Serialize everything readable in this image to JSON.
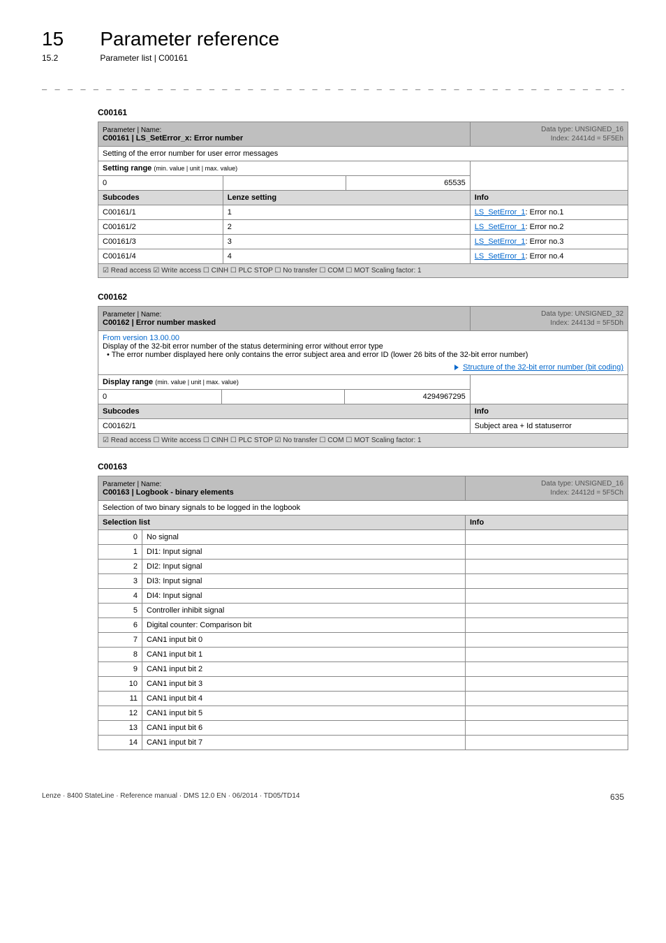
{
  "header": {
    "chapter_num": "15",
    "chapter_title": "Parameter reference",
    "section_num": "15.2",
    "section_title": "Parameter list | C00161",
    "dashes": "_ _ _ _ _ _ _ _ _ _ _ _ _ _ _ _ _ _ _ _ _ _ _ _ _ _ _ _ _ _ _ _ _ _ _ _ _ _ _ _ _ _ _ _ _ _ _ _ _ _ _ _ _ _ _ _ _ _ _ _ _ _ _ _"
  },
  "tables": {
    "t1": {
      "anchor": "C00161",
      "name_line1": "Parameter | Name:",
      "name_line2": "C00161 | LS_SetError_x: Error number",
      "dtype_line1": "Data type: UNSIGNED_16",
      "dtype_line2": "Index: 24414d = 5F5Eh",
      "desc": "Setting of the error number for user error messages",
      "setting_label": "Setting range",
      "setting_note": "(min. value | unit | max. value)",
      "min": "0",
      "max": "65535",
      "subcodes_hdr": "Subcodes",
      "lenze_hdr": "Lenze setting",
      "info_hdr": "Info",
      "rows": [
        {
          "sub": "C00161/1",
          "set": "1",
          "link": "LS_SetError_1",
          "rest": ": Error no.1"
        },
        {
          "sub": "C00161/2",
          "set": "2",
          "link": "LS_SetError_1",
          "rest": ": Error no.2"
        },
        {
          "sub": "C00161/3",
          "set": "3",
          "link": "LS_SetError_1",
          "rest": ": Error no.3"
        },
        {
          "sub": "C00161/4",
          "set": "4",
          "link": "LS_SetError_1",
          "rest": ": Error no.4"
        }
      ],
      "footer": "☑ Read access   ☑ Write access   ☐ CINH   ☐ PLC STOP   ☐ No transfer   ☐ COM   ☐ MOT     Scaling factor: 1"
    },
    "t2": {
      "anchor": "C00162",
      "name_line1": "Parameter | Name:",
      "name_line2": "C00162 | Error number masked",
      "dtype_line1": "Data type: UNSIGNED_32",
      "dtype_line2": "Index: 24413d = 5F5Dh",
      "version": "From version 13.00.00",
      "desc_text": "Display of the 32-bit error number of the status determining error without error type",
      "bullet": "• The error number displayed here only contains the error subject area and error ID (lower 26 bits of the 32-bit error number)",
      "struct_link": "Structure of the 32-bit error number (bit coding)",
      "display_label": "Display range",
      "display_note": "(min. value | unit | max. value)",
      "min": "0",
      "max": "4294967295",
      "subcodes_hdr": "Subcodes",
      "info_hdr": "Info",
      "row_sub": "C00162/1",
      "row_info": "Subject area + Id statuserror",
      "footer": "☑ Read access   ☐ Write access   ☐ CINH   ☐ PLC STOP   ☑ No transfer   ☐ COM   ☐ MOT     Scaling factor: 1"
    },
    "t3": {
      "anchor": "C00163",
      "name_line1": "Parameter | Name:",
      "name_line2": "C00163 | Logbook - binary elements",
      "dtype_line1": "Data type: UNSIGNED_16",
      "dtype_line2": "Index: 24412d = 5F5Ch",
      "desc": "Selection of two binary signals to be logged in the logbook",
      "sel_hdr": "Selection list",
      "info_hdr": "Info",
      "rows": [
        {
          "n": "0",
          "txt": "No signal"
        },
        {
          "n": "1",
          "txt": "DI1: Input signal"
        },
        {
          "n": "2",
          "txt": "DI2: Input signal"
        },
        {
          "n": "3",
          "txt": "DI3: Input signal"
        },
        {
          "n": "4",
          "txt": "DI4: Input signal"
        },
        {
          "n": "5",
          "txt": "Controller inhibit signal"
        },
        {
          "n": "6",
          "txt": "Digital counter: Comparison bit"
        },
        {
          "n": "7",
          "txt": "CAN1 input bit 0"
        },
        {
          "n": "8",
          "txt": "CAN1 input bit 1"
        },
        {
          "n": "9",
          "txt": "CAN1 input bit 2"
        },
        {
          "n": "10",
          "txt": "CAN1 input bit 3"
        },
        {
          "n": "11",
          "txt": "CAN1 input bit 4"
        },
        {
          "n": "12",
          "txt": "CAN1 input bit 5"
        },
        {
          "n": "13",
          "txt": "CAN1 input bit 6"
        },
        {
          "n": "14",
          "txt": "CAN1 input bit 7"
        }
      ]
    }
  },
  "footer": {
    "left": "Lenze · 8400 StateLine · Reference manual · DMS 12.0 EN · 06/2014 · TD05/TD14",
    "right": "635"
  }
}
